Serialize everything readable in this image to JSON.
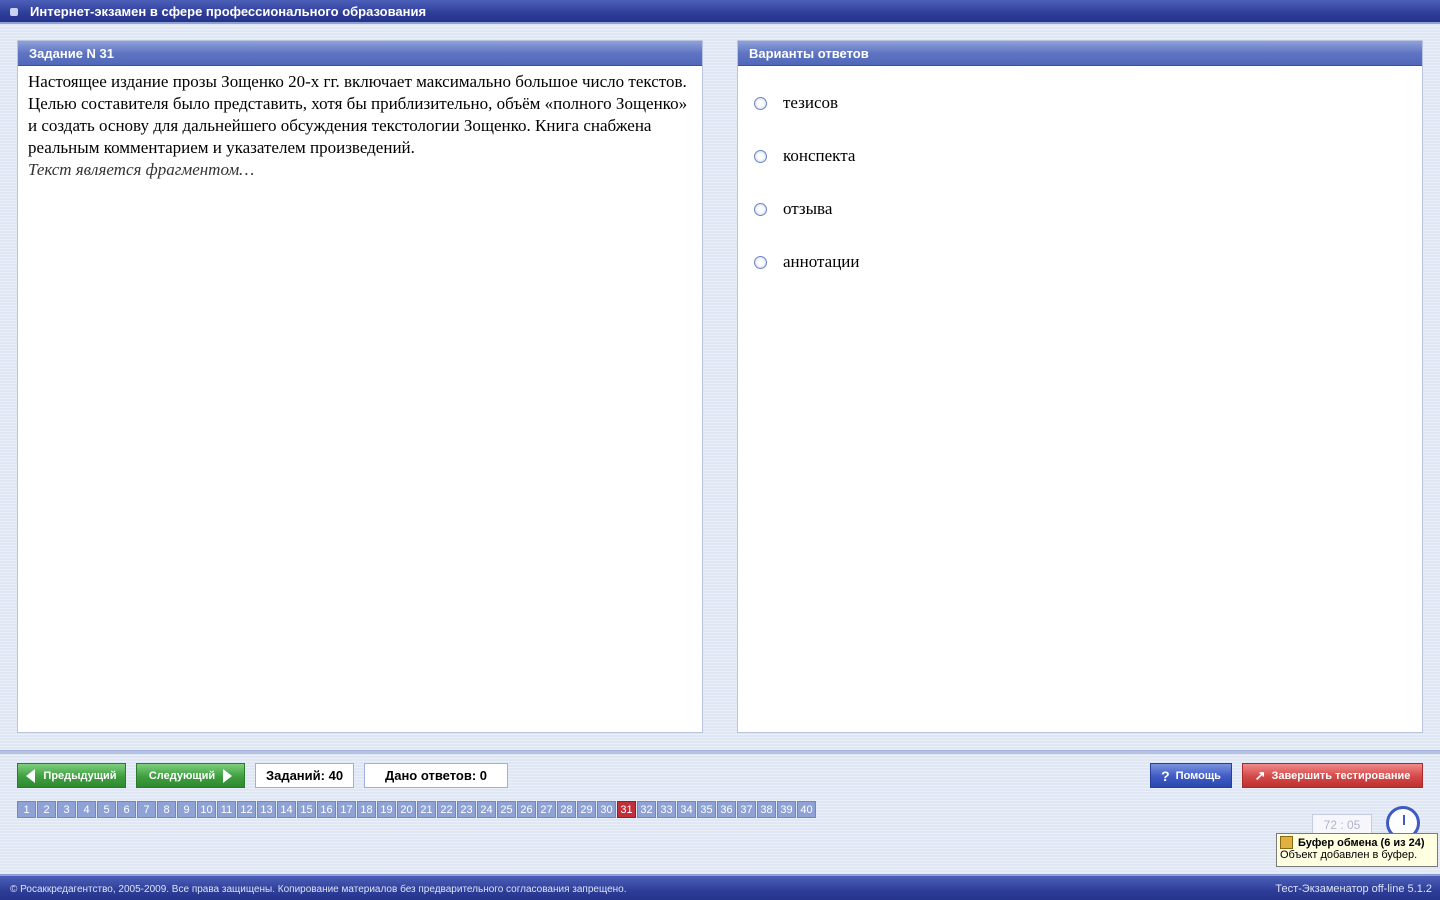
{
  "title": "Интернет-экзамен в сфере профессионального образования",
  "question_panel": {
    "header": "Задание N 31",
    "text": "Настоящее издание прозы Зощенко 20-х гг. включает максимально большое число текстов. Целью составителя было представить, хотя бы приблизительно, объём «полного Зощенко» и создать основу для дальнейшего обсуждения текстологии Зощенко. Книга снабжена реальным комментарием и указателем произведений.",
    "note": "Текст является фрагментом…"
  },
  "answers_panel": {
    "header": "Варианты ответов",
    "options": [
      "тезисов",
      "конспекта",
      "отзыва",
      "аннотации"
    ]
  },
  "nav": {
    "prev": "Предыдущий",
    "next": "Следующий",
    "tasks_count": "Заданий: 40",
    "answers_given": "Дано ответов: 0",
    "help": "Помощь",
    "finish": "Завершить тестирование"
  },
  "pages": [
    "1",
    "2",
    "3",
    "4",
    "5",
    "6",
    "7",
    "8",
    "9",
    "10",
    "11",
    "12",
    "13",
    "14",
    "15",
    "16",
    "17",
    "18",
    "19",
    "20",
    "21",
    "22",
    "23",
    "24",
    "25",
    "26",
    "27",
    "28",
    "29",
    "30",
    "31",
    "32",
    "33",
    "34",
    "35",
    "36",
    "37",
    "38",
    "39",
    "40"
  ],
  "current_page": "31",
  "timer": "72 : 05",
  "clipboard": {
    "title": "Буфер обмена (6 из 24)",
    "message": "Объект добавлен в буфер."
  },
  "footer": {
    "copyright": "© Росаккредагентство, 2005-2009. Все права защищены. Копирование материалов без предварительного согласования запрещено.",
    "version": "Тест-Экзаменатор off-line 5.1.2"
  },
  "colors": {
    "titlebar": "#2e3e98",
    "panel_header": "#5f75c2",
    "current_page": "#c0303a",
    "button_green": "#3f9e3f",
    "button_red": "#d44848"
  }
}
